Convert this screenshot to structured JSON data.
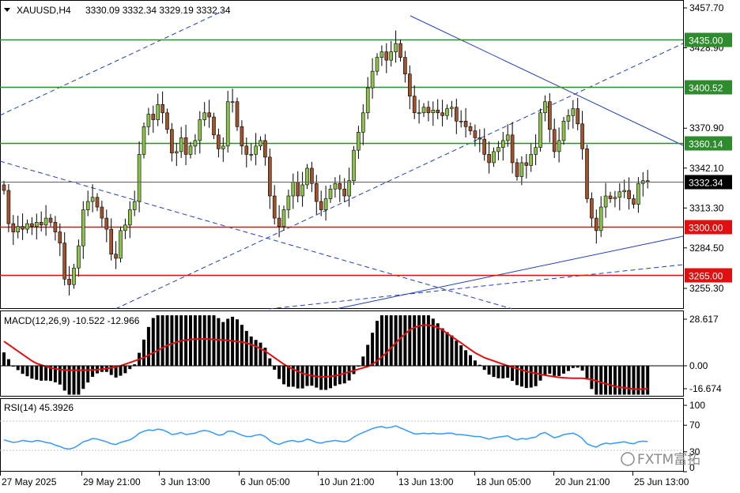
{
  "header": {
    "symbol": "XAUUSD,H4",
    "ohlc": "3330.09 3332.34 3329.19 3332.34"
  },
  "price_axis": {
    "ticks": [
      "3457.70",
      "3428.90",
      "3370.90",
      "3342.10",
      "3313.30",
      "3284.50",
      "3255.30"
    ],
    "current_price": "3332.34",
    "levels": [
      {
        "label": "3435.00",
        "value": 3435.0,
        "color": "#2e8b2e"
      },
      {
        "label": "3400.52",
        "value": 3400.52,
        "color": "#2e8b2e"
      },
      {
        "label": "3360.14",
        "value": 3360.14,
        "color": "#2e8b2e"
      },
      {
        "label": "3300.00",
        "value": 3300.0,
        "color": "#e01010"
      },
      {
        "label": "3265.00",
        "value": 3265.0,
        "color": "#e01010"
      }
    ]
  },
  "time_axis": {
    "labels": [
      "27 May 2025",
      "29 May 21:00",
      "3 Jun 13:00",
      "6 Jun 05:00",
      "10 Jun 21:00",
      "13 Jun 13:00",
      "18 Jun 05:00",
      "20 Jun 21:00",
      "25 Jun 13:00"
    ]
  },
  "macd_panel": {
    "title": "MACD(12,26,9) -10.522 -12.966",
    "ticks": [
      "28.617",
      "0.00",
      "-16.674"
    ]
  },
  "rsi_panel": {
    "title": "RSI(14) 45.3926",
    "ticks": [
      "100",
      "70",
      "30",
      "0"
    ]
  },
  "watermark": {
    "text": "FXTM富拓"
  },
  "colors": {
    "bull": "#8bc34a",
    "bear": "#a0522d",
    "wick": "#000000",
    "signal": "#e01010",
    "rsi": "#3399ff",
    "trend": "#1f3fbf"
  },
  "chart_data": [
    {
      "type": "candlestick",
      "title": "XAUUSD,H4",
      "ylim": [
        3245,
        3462
      ],
      "x_labels": [
        "27 May 2025",
        "29 May 21:00",
        "3 Jun 13:00",
        "6 Jun 05:00",
        "10 Jun 21:00",
        "13 Jun 13:00",
        "18 Jun 05:00",
        "20 Jun 21:00",
        "25 Jun 13:00"
      ],
      "closes": [
        3326,
        3302,
        3296,
        3300,
        3298,
        3302,
        3300,
        3303,
        3301,
        3306,
        3303,
        3296,
        3288,
        3262,
        3258,
        3270,
        3286,
        3312,
        3318,
        3321,
        3314,
        3306,
        3298,
        3280,
        3277,
        3297,
        3301,
        3312,
        3318,
        3352,
        3372,
        3381,
        3377,
        3388,
        3382,
        3370,
        3353,
        3354,
        3364,
        3352,
        3358,
        3362,
        3377,
        3382,
        3379,
        3366,
        3356,
        3358,
        3390,
        3390,
        3372,
        3358,
        3352,
        3352,
        3358,
        3362,
        3350,
        3322,
        3306,
        3300,
        3312,
        3322,
        3332,
        3322,
        3330,
        3342,
        3331,
        3318,
        3312,
        3320,
        3327,
        3331,
        3327,
        3322,
        3333,
        3355,
        3368,
        3382,
        3400,
        3412,
        3422,
        3426,
        3420,
        3426,
        3432,
        3422,
        3410,
        3394,
        3382,
        3382,
        3386,
        3382,
        3384,
        3382,
        3380,
        3385,
        3386,
        3376,
        3376,
        3372,
        3369,
        3364,
        3363,
        3352,
        3346,
        3354,
        3357,
        3362,
        3366,
        3346,
        3336,
        3346,
        3344,
        3352,
        3357,
        3382,
        3390,
        3370,
        3354,
        3362,
        3376,
        3380,
        3385,
        3374,
        3356,
        3320,
        3306,
        3297,
        3314,
        3322,
        3320,
        3321,
        3325,
        3326,
        3320,
        3316,
        3331,
        3333,
        3332
      ],
      "current": 3332.34,
      "levels": [
        3435.0,
        3400.52,
        3360.14,
        3300.0,
        3265.0
      ]
    },
    {
      "type": "bar",
      "title": "MACD(12,26,9) -10.522 -12.966",
      "macd_value": -10.522,
      "signal_value": -12.966,
      "ylim": [
        -23,
        33
      ],
      "y_ticks": [
        28.617,
        0.0,
        -16.674
      ],
      "signal": [
        15,
        13,
        11,
        9,
        7,
        5,
        3,
        1.5,
        0.5,
        -0.5,
        -1.5,
        -2.2,
        -2.7,
        -3,
        -3.2,
        -3.2,
        -3.2,
        -3.2,
        -3.1,
        -3,
        -2.8,
        -2.5,
        -2,
        -1.5,
        -0.8,
        0,
        1,
        2,
        3,
        4,
        5,
        6.5,
        8,
        9.5,
        11,
        12.5,
        13.5,
        14.5,
        15.3,
        15.8,
        16.2,
        16.4,
        16.5,
        16.5,
        16.4,
        16.2,
        16,
        15.8,
        15.6,
        15.3,
        15,
        14.6,
        14,
        13,
        12,
        10.5,
        9,
        7,
        5,
        3,
        1,
        -1,
        -2.5,
        -4,
        -5.5,
        -6.5,
        -7.2,
        -7.7,
        -8,
        -8,
        -7.7,
        -7.2,
        -6.5,
        -5.5,
        -4.5,
        -3.5,
        -2.5,
        -1.5,
        -0.5,
        1,
        3,
        5.5,
        8,
        11,
        14,
        17,
        19.5,
        22,
        23.5,
        24.5,
        25,
        25,
        24.5,
        23.5,
        22,
        20,
        18,
        16,
        14,
        12,
        10,
        8,
        6.5,
        5,
        4,
        3,
        2,
        1,
        0,
        -1,
        -2,
        -3,
        -4,
        -4.8,
        -5.5,
        -6.2,
        -6.9,
        -7.4,
        -8,
        -8.4,
        -8.7,
        -8.9,
        -9,
        -9,
        -9,
        -9.5,
        -10,
        -11,
        -12,
        -13,
        -14,
        -15,
        -15.5,
        -16,
        -16.5,
        -16.8,
        -17,
        -17,
        -16.5
      ]
    },
    {
      "type": "line",
      "title": "RSI(14) 45.3926",
      "ylim": [
        0,
        100
      ],
      "reference_levels": [
        70,
        30
      ],
      "values": [
        48,
        46,
        44,
        45,
        47,
        46,
        45,
        47,
        46,
        44,
        43,
        40,
        38,
        35,
        34,
        36,
        40,
        45,
        47,
        50,
        49,
        47,
        45,
        42,
        41,
        44,
        46,
        48,
        52,
        58,
        61,
        63,
        62,
        64,
        63,
        60,
        56,
        57,
        59,
        56,
        57,
        58,
        61,
        62,
        61,
        58,
        55,
        56,
        61,
        61,
        58,
        55,
        53,
        53,
        55,
        56,
        53,
        47,
        43,
        41,
        44,
        46,
        47,
        45,
        46,
        49,
        47,
        44,
        43,
        45,
        46,
        47,
        46,
        45,
        47,
        52,
        56,
        59,
        62,
        65,
        67,
        68,
        66,
        67,
        69,
        66,
        63,
        60,
        57,
        57,
        58,
        57,
        58,
        57,
        57,
        58,
        58,
        56,
        56,
        55,
        54,
        53,
        53,
        51,
        49,
        51,
        52,
        53,
        54,
        50,
        48,
        50,
        49,
        51,
        52,
        57,
        59,
        55,
        51,
        53,
        56,
        57,
        58,
        55,
        50,
        42,
        39,
        37,
        41,
        43,
        42,
        43,
        44,
        45,
        43,
        42,
        45,
        46,
        45.4
      ]
    }
  ]
}
